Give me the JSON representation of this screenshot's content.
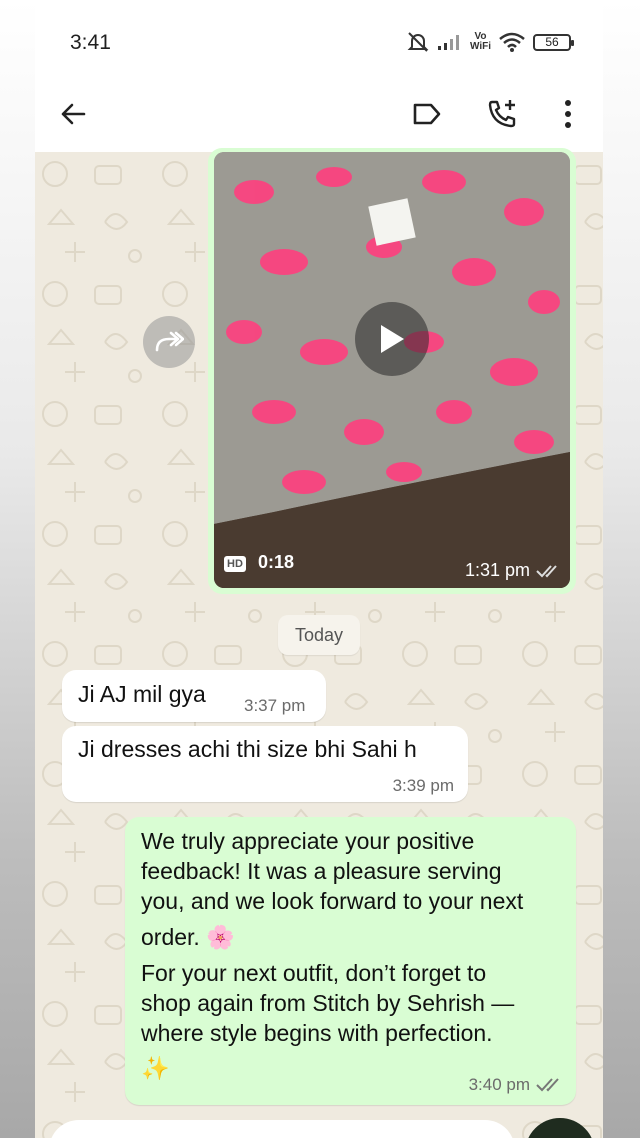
{
  "status_bar": {
    "time": "3:41",
    "network_label": "Vo\nWiFi",
    "battery": "56"
  },
  "app_bar": {
    "icons": [
      "back-arrow-icon",
      "label-icon",
      "add-call-icon",
      "more-vert-icon"
    ]
  },
  "video_message": {
    "badge": "HD",
    "duration": "0:18",
    "time": "1:31 pm",
    "status": "read"
  },
  "date_divider": "Today",
  "messages": [
    {
      "direction": "incoming",
      "text": "Ji AJ mil gya",
      "time": "3:37 pm"
    },
    {
      "direction": "incoming",
      "text": "Ji dresses achi thi size bhi Sahi h",
      "time": "3:39 pm"
    },
    {
      "direction": "outgoing",
      "lines": [
        "We truly appreciate your positive",
        "feedback! It was a pleasure serving",
        "you, and we look forward to your next",
        "order. 🌸",
        "For your next outfit, don’t forget to",
        "shop again from Stitch by Sehrish —",
        "where style begins with perfection.",
        "✨"
      ],
      "time": "3:40 pm",
      "status": "read"
    }
  ],
  "colors": {
    "outgoing_bubble": "#d9fdd3",
    "incoming_bubble": "#ffffff",
    "wallpaper": "#efeadf",
    "read_ticks": "#8a8a8a"
  }
}
